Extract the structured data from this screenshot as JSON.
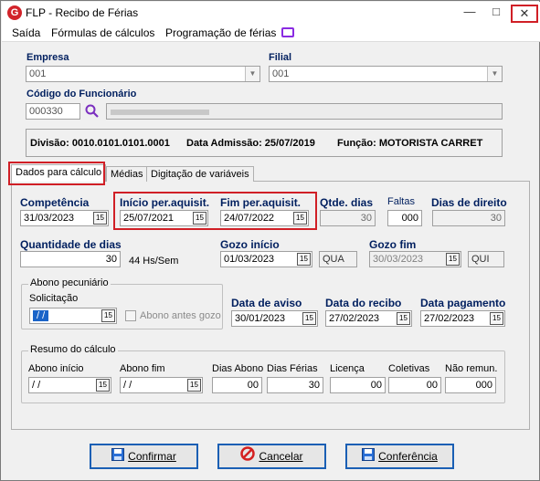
{
  "window": {
    "title": "FLP - Recibo de Férias",
    "close": "✕",
    "minimize": "—",
    "maximize": "□"
  },
  "menu": [
    {
      "label": "Saída"
    },
    {
      "label": "Fórmulas de cálculos"
    },
    {
      "label": "Programação de férias"
    }
  ],
  "header": {
    "empresa_label": "Empresa",
    "empresa_value": "001",
    "filial_label": "Filial",
    "filial_value": "001",
    "funcionario_label": "Código do Funcionário",
    "funcionario_code": "000330",
    "divisao": "Divisão: 0010.0101.0101.0001",
    "admissao": "Data Admissão: 25/07/2019",
    "funcao": "Função: MOTORISTA CARRET"
  },
  "tabs": [
    {
      "label": "Dados para cálculo"
    },
    {
      "label": "Médias"
    },
    {
      "label": "Digitação de variáveis"
    }
  ],
  "form": {
    "competencia_label": "Competência",
    "competencia": "31/03/2023",
    "inicio_label": "Início per.aquisit.",
    "inicio": "25/07/2021",
    "fim_label": "Fim per.aquisit.",
    "fim": "24/07/2022",
    "qtde_dias_label": "Qtde. dias",
    "qtde_dias": "30",
    "faltas_label": "Faltas",
    "faltas": "000",
    "dias_direito_label": "Dias de direito",
    "dias_direito": "30",
    "qtd_dias_label": "Quantidade de dias",
    "qtd_dias": "30",
    "hs_sem": "44 Hs/Sem",
    "gozo_inicio_label": "Gozo início",
    "gozo_inicio": "01/03/2023",
    "gozo_inicio_dia": "QUA",
    "gozo_fim_label": "Gozo fim",
    "gozo_fim": "30/03/2023",
    "gozo_fim_dia": "QUI",
    "abono_group": "Abono pecuniário",
    "solicitacao_label": "Solicitação",
    "solicitacao": " / /",
    "abono_antes_gozo": "Abono antes gozo",
    "data_aviso_label": "Data de aviso",
    "data_aviso": "30/01/2023",
    "data_recibo_label": "Data do recibo",
    "data_recibo": "27/02/2023",
    "data_pagamento_label": "Data pagamento",
    "data_pagamento": "27/02/2023",
    "resumo_group": "Resumo do cálculo",
    "abono_inicio_label": "Abono início",
    "abono_inicio": " / /",
    "abono_fim_label": "Abono fim",
    "abono_fim": " / /",
    "dias_abono_label": "Dias Abono",
    "dias_abono": "00",
    "dias_ferias_label": "Dias Férias",
    "dias_ferias": "30",
    "licenca_label": "Licença",
    "licenca": "00",
    "coletivas_label": "Coletivas",
    "coletivas": "00",
    "nao_remun_label": "Não remun.",
    "nao_remun": "000",
    "cal_glyph": "15"
  },
  "buttons": {
    "confirmar": "Confirmar",
    "cancelar": "Cancelar",
    "conferencia": "Conferência"
  },
  "colors": {
    "highlight": "#d01f26",
    "button_border": "#1a5fb4"
  }
}
